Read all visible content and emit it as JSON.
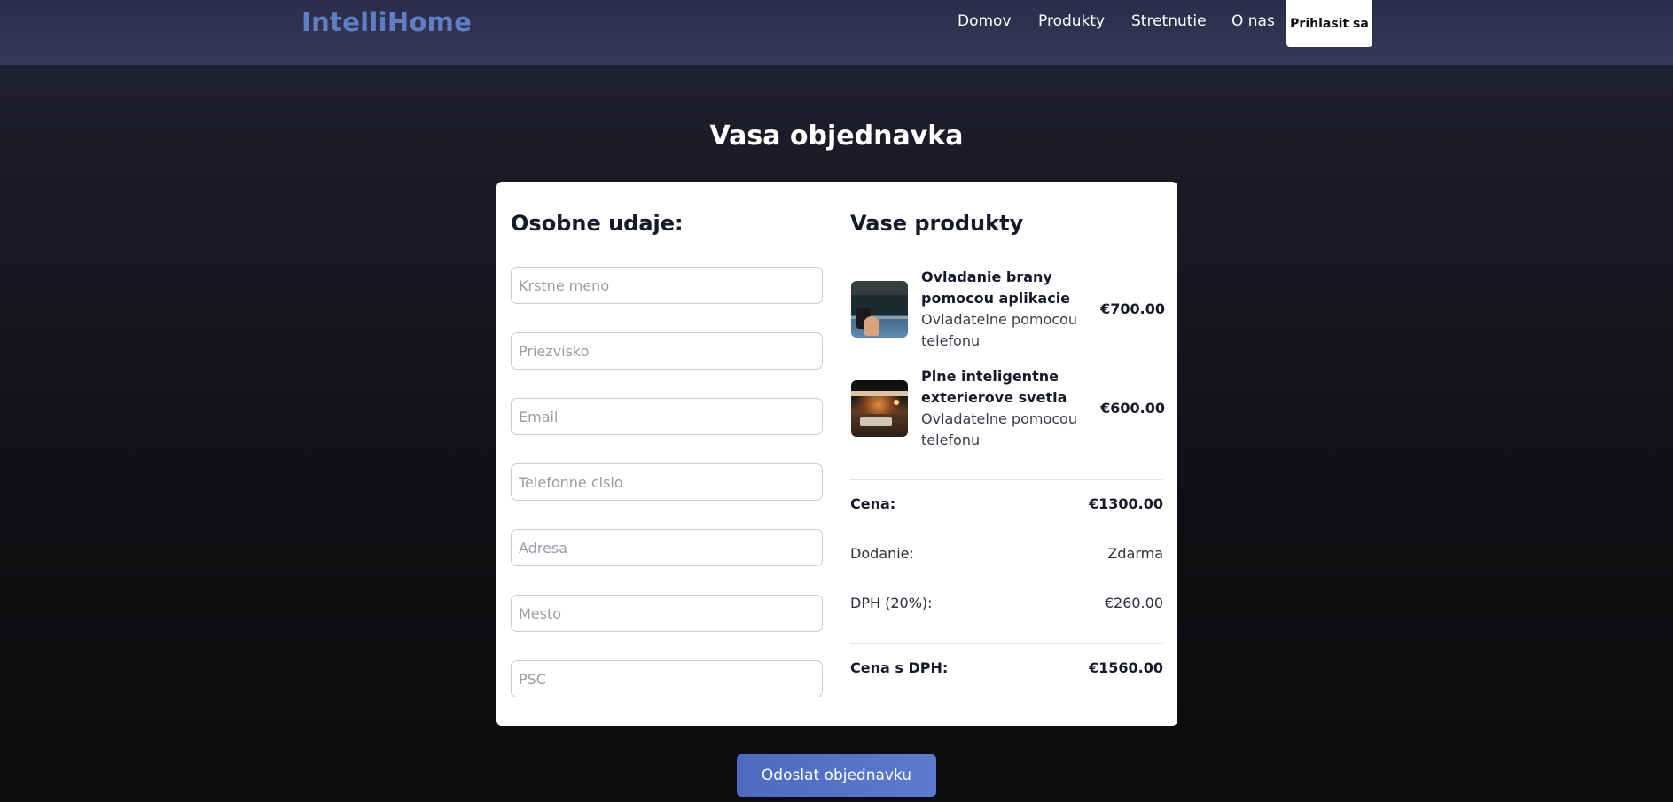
{
  "header": {
    "logo": "IntelliHome",
    "nav": [
      "Domov",
      "Produkty",
      "Stretnutie",
      "O nas"
    ],
    "login_label": "Prihlasit sa"
  },
  "page": {
    "title": "Vasa objednavka"
  },
  "personal": {
    "title": "Osobne udaje:",
    "fields": [
      {
        "placeholder": "Krstne meno",
        "value": ""
      },
      {
        "placeholder": "Priezvisko",
        "value": ""
      },
      {
        "placeholder": "Email",
        "value": ""
      },
      {
        "placeholder": "Telefonne cislo",
        "value": ""
      },
      {
        "placeholder": "Adresa",
        "value": ""
      },
      {
        "placeholder": "Mesto",
        "value": ""
      },
      {
        "placeholder": "PSC",
        "value": ""
      }
    ]
  },
  "products": {
    "title": "Vase produkty",
    "items": [
      {
        "name": "Ovladanie brany pomocou aplikacie",
        "desc": "Ovladatelne pomocou telefonu",
        "price": "€700.00"
      },
      {
        "name": "Plne inteligentne exterierove svetla",
        "desc": "Ovladatelne pomocou telefonu",
        "price": "€600.00"
      }
    ]
  },
  "summary": {
    "price_label": "Cena:",
    "price_value": "€1300.00",
    "delivery_label": "Dodanie:",
    "delivery_value": "Zdarma",
    "vat_label": "DPH (20%):",
    "vat_value": "€260.00",
    "total_label": "Cena s DPH:",
    "total_value": "€1560.00"
  },
  "actions": {
    "submit_label": "Odoslat objednavku"
  }
}
